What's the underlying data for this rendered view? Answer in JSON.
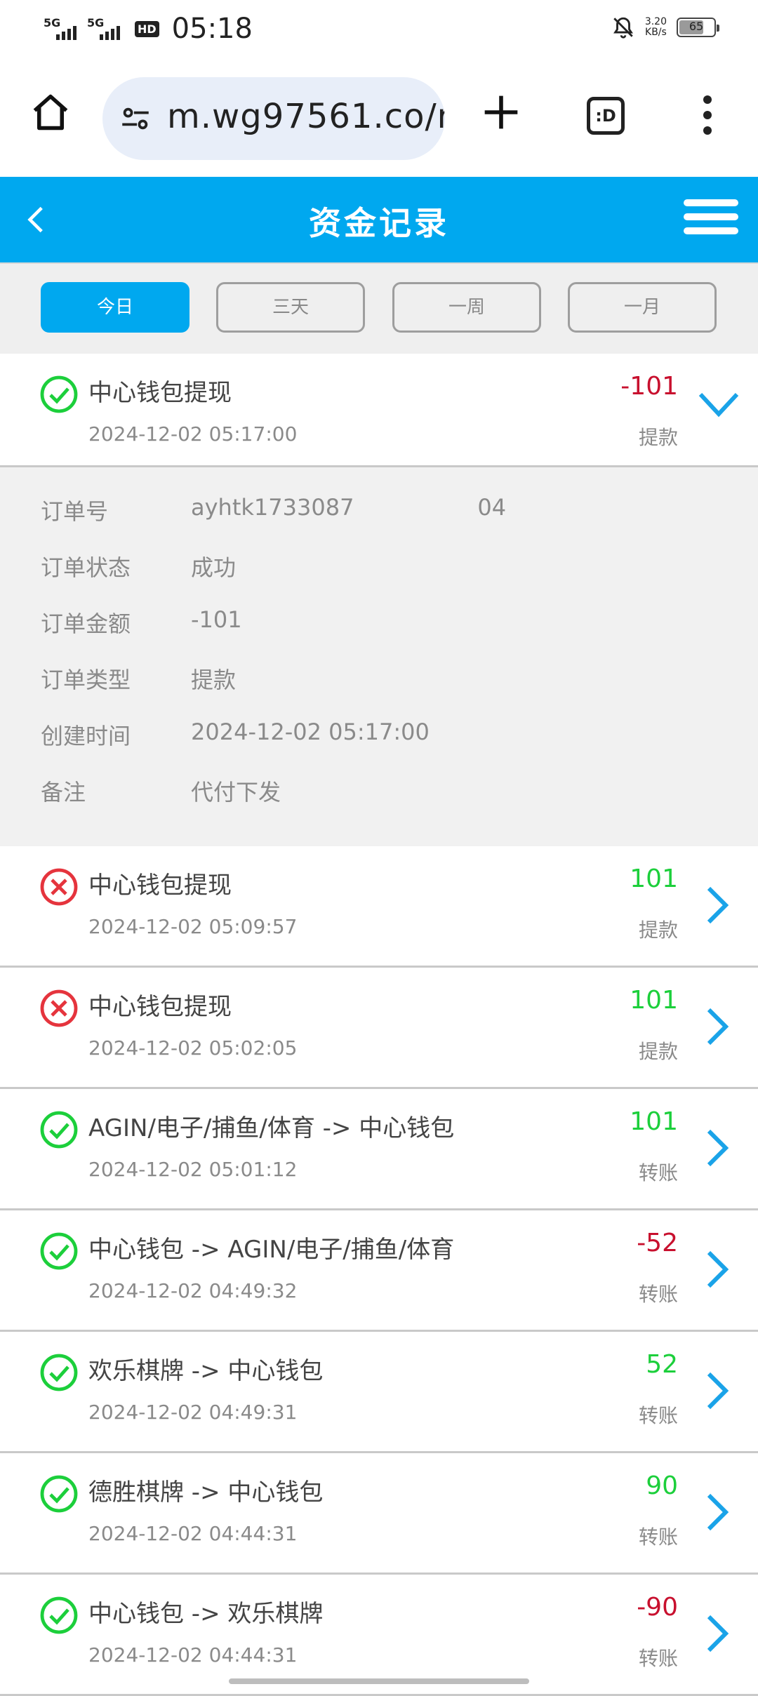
{
  "status_bar": {
    "signal1_label": "5G",
    "signal2_label": "5G",
    "hd_label": "HD",
    "time": "05:18",
    "net_speed_value": "3.20",
    "net_speed_unit": "KB/s",
    "battery": "65"
  },
  "browser": {
    "url": "m.wg97561.co/r",
    "tabs_label": ":D"
  },
  "header": {
    "title": "资金记录"
  },
  "filters": [
    {
      "label": "今日",
      "active": true
    },
    {
      "label": "三天",
      "active": false
    },
    {
      "label": "一周",
      "active": false
    },
    {
      "label": "一月",
      "active": false
    }
  ],
  "records": [
    {
      "title": "中心钱包提现",
      "time": "2024-12-02 05:17:00",
      "amount": "-101",
      "type": "提款",
      "status": "success",
      "expanded": true
    },
    {
      "title": "中心钱包提现",
      "time": "2024-12-02 05:09:57",
      "amount": "101",
      "type": "提款",
      "status": "failed"
    },
    {
      "title": "中心钱包提现",
      "time": "2024-12-02 05:02:05",
      "amount": "101",
      "type": "提款",
      "status": "failed"
    },
    {
      "title": "AGIN/电子/捕鱼/体育 -> 中心钱包",
      "time": "2024-12-02 05:01:12",
      "amount": "101",
      "type": "转账",
      "status": "success"
    },
    {
      "title": "中心钱包 -> AGIN/电子/捕鱼/体育",
      "time": "2024-12-02 04:49:32",
      "amount": "-52",
      "type": "转账",
      "status": "success"
    },
    {
      "title": "欢乐棋牌 -> 中心钱包",
      "time": "2024-12-02 04:49:31",
      "amount": "52",
      "type": "转账",
      "status": "success"
    },
    {
      "title": "德胜棋牌 -> 中心钱包",
      "time": "2024-12-02 04:44:31",
      "amount": "90",
      "type": "转账",
      "status": "success"
    },
    {
      "title": "中心钱包 -> 欢乐棋牌",
      "time": "2024-12-02 04:44:31",
      "amount": "-90",
      "type": "转账",
      "status": "success"
    }
  ],
  "details": [
    {
      "label": "订单号",
      "value": "ayhtk1733087"
    },
    {
      "label": "订单状态",
      "value": "成功"
    },
    {
      "label": "订单金额",
      "value": "-101"
    },
    {
      "label": "订单类型",
      "value": "提款"
    },
    {
      "label": "创建时间",
      "value": "2024-12-02 05:17:00"
    },
    {
      "label": "备注",
      "value": "代付下发"
    }
  ],
  "details_order_suffix": "04",
  "colors": {
    "brand": "#00a8ef",
    "positive": "#1ccf3b",
    "negative": "#c8102e",
    "success_icon": "#1ccf3b",
    "failed_icon": "#e5343d"
  }
}
